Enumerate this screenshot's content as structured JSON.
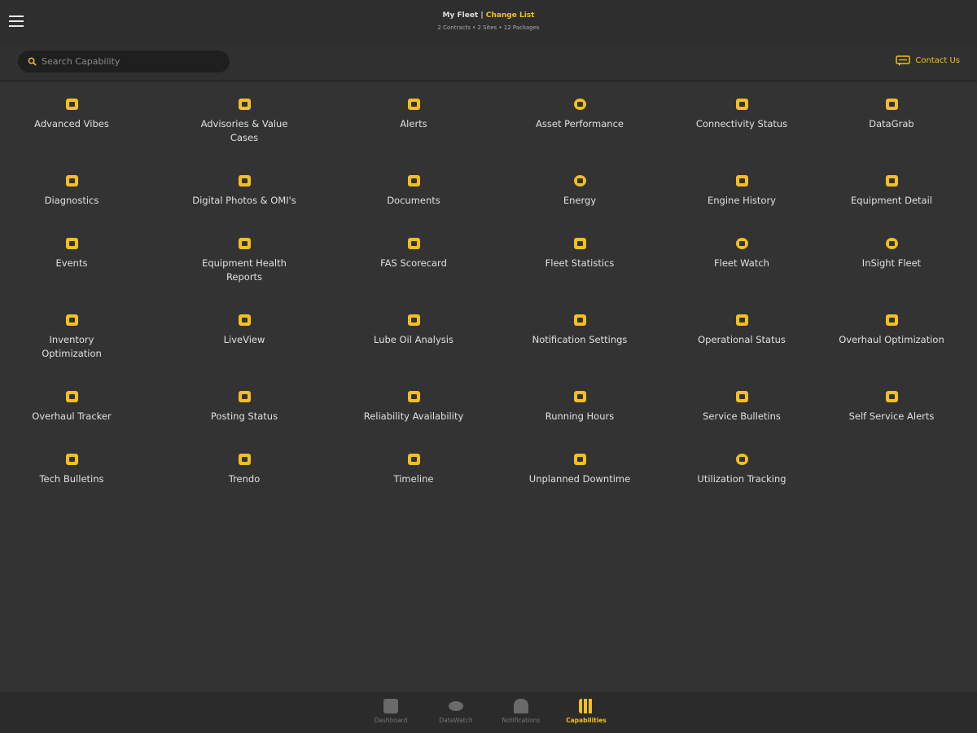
{
  "header": {
    "title": "My Fleet",
    "separator": " | ",
    "change_link": "Change List",
    "subtitle": "2 Contracts • 2 Sites • 12 Packages"
  },
  "search": {
    "placeholder": "Search Capability",
    "value": ""
  },
  "contact": {
    "label": "Contact Us"
  },
  "capabilities": [
    "Advanced Vibes",
    "Advisories & Value Cases",
    "Alerts",
    "Asset Performance",
    "Connectivity Status",
    "DataGrab",
    "Diagnostics",
    "Digital Photos & OMI's",
    "Documents",
    "Energy",
    "Engine History",
    "Equipment Detail",
    "Events",
    "Equipment Health Reports",
    "FAS Scorecard",
    "Fleet Statistics",
    "Fleet Watch",
    "InSight Fleet",
    "Inventory Optimization",
    "LiveView",
    "Lube Oil Analysis",
    "Notification Settings",
    "Operational Status",
    "Overhaul Optimization",
    "Overhaul Tracker",
    "Posting Status",
    "Reliability Availability",
    "Running Hours",
    "Service Bulletins",
    "Self Service Alerts",
    "Tech Bulletins",
    "Trendo",
    "Timeline",
    "Unplanned Downtime",
    "Utilization Tracking"
  ],
  "bottom_nav": [
    {
      "label": "Dashboard"
    },
    {
      "label": "DataWatch"
    },
    {
      "label": "Notifications"
    },
    {
      "label": "Capabilities",
      "active": true
    }
  ],
  "colors": {
    "accent": "#f2c01e",
    "background": "#333333"
  }
}
